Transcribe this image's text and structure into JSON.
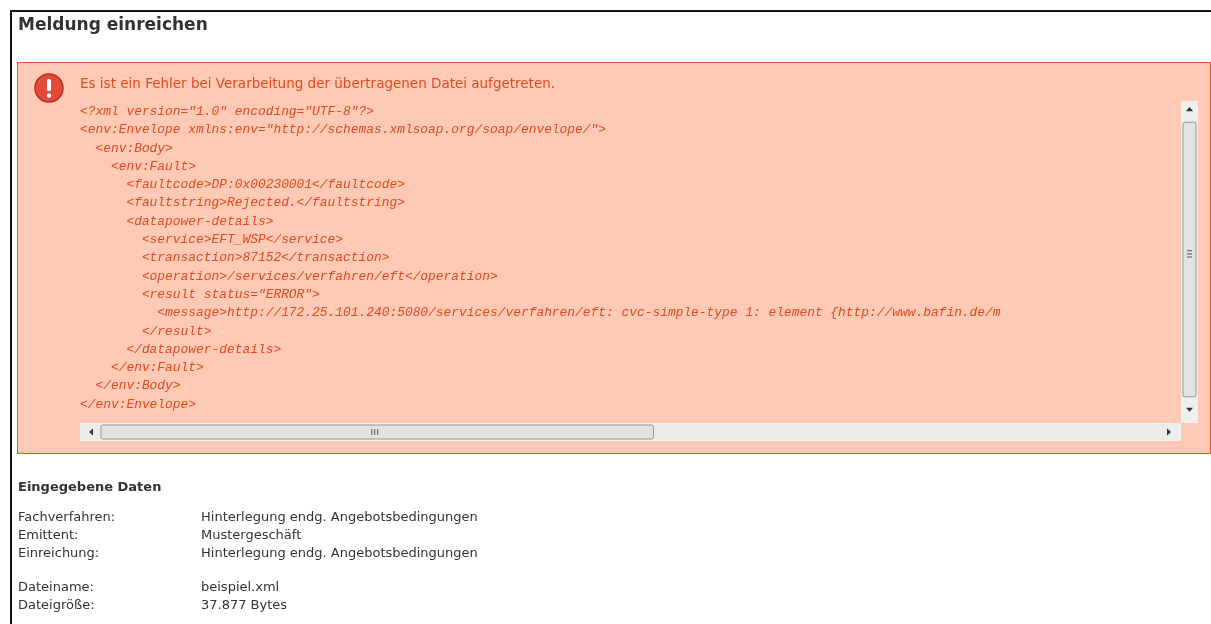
{
  "page": {
    "title": "Meldung einreichen"
  },
  "error": {
    "message": "Es ist ein Fehler bei Verarbeitung der übertragenen Datei aufgetreten.",
    "code_lines": [
      "<?xml version=\"1.0\" encoding=\"UTF-8\"?>",
      "<env:Envelope xmlns:env=\"http://schemas.xmlsoap.org/soap/envelope/\">",
      "  <env:Body>",
      "    <env:Fault>",
      "      <faultcode>DP:0x00230001</faultcode>",
      "      <faultstring>Rejected.</faultstring>",
      "      <datapower-details>",
      "        <service>EFT_WSP</service>",
      "        <transaction>87152</transaction>",
      "        <operation>/services/verfahren/eft</operation>",
      "        <result status=\"ERROR\">",
      "          <message>http://172.25.101.240:5080/services/verfahren/eft: cvc-simple-type 1: element {http://www.bafin.de/m",
      "        </result>",
      "      </datapower-details>",
      "    </env:Fault>",
      "  </env:Body>",
      "</env:Envelope>"
    ]
  },
  "entered_data": {
    "heading": "Eingegebene Daten",
    "groups": [
      [
        {
          "label": "Fachverfahren:",
          "value": "Hinterlegung endg. Angebotsbedingungen"
        },
        {
          "label": "Emittent:",
          "value": "Mustergeschäft"
        },
        {
          "label": "Einreichung:",
          "value": "Hinterlegung endg. Angebotsbedingungen"
        }
      ],
      [
        {
          "label": "Dateiname:",
          "value": "beispiel.xml"
        },
        {
          "label": "Dateigröße:",
          "value": "37.877 Bytes"
        }
      ]
    ]
  }
}
